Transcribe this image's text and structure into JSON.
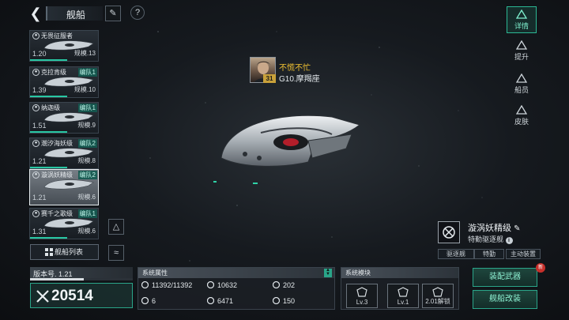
{
  "header": {
    "title": "舰船",
    "back_icon": "back-arrow-icon",
    "buttons": [
      "edit-icon",
      "help-icon"
    ]
  },
  "ship_list": [
    {
      "name": "无畏征服者",
      "level": "1.20",
      "team": "",
      "scale": "规模.13",
      "selected": false
    },
    {
      "name": "克拉肯级",
      "level": "1.39",
      "team": "编队1",
      "scale": "规模.10",
      "selected": false
    },
    {
      "name": "纳迦级",
      "level": "1.51",
      "team": "编队1",
      "scale": "规模.9",
      "selected": false
    },
    {
      "name": "潮汐海妖级",
      "level": "1.21",
      "team": "编队2",
      "scale": "规模.8",
      "selected": false
    },
    {
      "name": "漩涡妖精级",
      "level": "1.21",
      "team": "编队2",
      "scale": "规模.6",
      "selected": true
    },
    {
      "name": "赛千之歌级",
      "level": "1.31",
      "team": "编队1",
      "scale": "规模.6",
      "selected": false
    }
  ],
  "ship_list_button": "舰船列表",
  "side_tabs": [
    {
      "label": "详情",
      "icon": "detail-icon",
      "active": true
    },
    {
      "label": "提升",
      "icon": "upgrade-icon",
      "active": false
    },
    {
      "label": "船员",
      "icon": "crew-icon",
      "active": false
    },
    {
      "label": "皮肤",
      "icon": "skin-icon",
      "active": false
    }
  ],
  "captain": {
    "name": "不慌不忙",
    "level": "31",
    "location": "G10.摩羯座"
  },
  "ship_info": {
    "name": "漩涡妖精级",
    "type": "特勤驱逐舰",
    "tags": [
      "驱逐舰",
      "特勤",
      "主动装置"
    ]
  },
  "version": {
    "label": "版本号. 1.21",
    "power": "20514",
    "progress": 0.52
  },
  "system_attributes": {
    "header": "系统属性",
    "stats": [
      {
        "icon": "shield-icon",
        "value": "11392/11392"
      },
      {
        "icon": "armor-icon",
        "value": "10632"
      },
      {
        "icon": "speed-icon",
        "value": "202"
      },
      {
        "icon": "grid-icon",
        "value": "6"
      },
      {
        "icon": "target-icon",
        "value": "6471"
      },
      {
        "icon": "cargo-icon",
        "value": "150"
      }
    ]
  },
  "system_modules": {
    "header": "系统模块",
    "modules": [
      {
        "label": "Lv.3",
        "icon": "shield-module-icon"
      },
      {
        "label": "Lv.1",
        "icon": "thruster-module-icon"
      },
      {
        "label": "2.01解锁",
        "icon": "lock-icon"
      }
    ]
  },
  "actions": {
    "equip": "装配武器",
    "refit": "舰船改装",
    "badge": "新"
  },
  "colors": {
    "accent": "#2bb894",
    "gold": "#f1c232",
    "background": "#161a1f"
  }
}
